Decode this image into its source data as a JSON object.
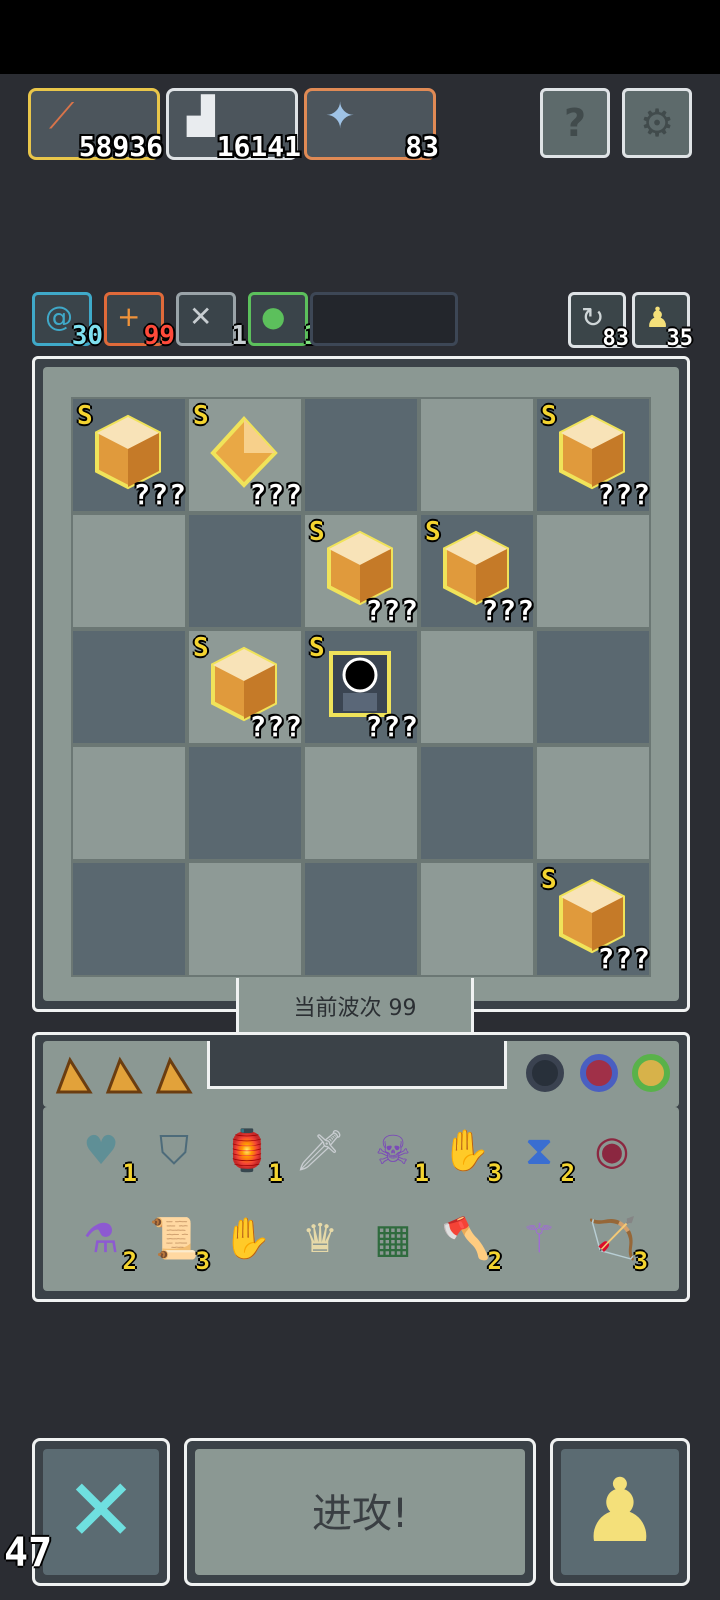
{
  "resources": [
    {
      "icon": "axe-icon",
      "glyph": "🪓",
      "value": "58936"
    },
    {
      "icon": "anvil-icon",
      "glyph": "⚒",
      "value": "16141"
    },
    {
      "icon": "crossbow-icon",
      "glyph": "🏹",
      "value": "83"
    }
  ],
  "top_buttons": {
    "help_glyph": "?",
    "settings_glyph": "⚙"
  },
  "status_chips": [
    {
      "icon": "spiral-icon",
      "glyph": "@",
      "value": "30",
      "color": "#3fa9c9"
    },
    {
      "icon": "plus-icon",
      "glyph": "+",
      "value": "99",
      "color": "#e06a3a"
    },
    {
      "icon": "swords-icon",
      "glyph": "✕",
      "value": "1",
      "color": "#9aa3a8"
    },
    {
      "icon": "leaf-icon",
      "glyph": "●",
      "value": "1",
      "color": "#5cc05c"
    }
  ],
  "mini_counters": [
    {
      "icon": "refresh-icon",
      "glyph": "↻",
      "value": "83"
    },
    {
      "icon": "pawn-icon",
      "glyph": "♟",
      "value": "35"
    }
  ],
  "board": {
    "cells": [
      {
        "rank": "S",
        "label": "???",
        "item": "cube-gem"
      },
      {
        "rank": "S",
        "label": "???",
        "item": "diamond-gem"
      },
      null,
      null,
      {
        "rank": "S",
        "label": "???",
        "item": "cube-gem"
      },
      null,
      null,
      {
        "rank": "S",
        "label": "???",
        "item": "cube-gem"
      },
      {
        "rank": "S",
        "label": "???",
        "item": "cube-gem"
      },
      null,
      null,
      {
        "rank": "S",
        "label": "???",
        "item": "cube-gem"
      },
      {
        "rank": "S",
        "label": "???",
        "item": "dark-portal"
      },
      null,
      null,
      null,
      null,
      null,
      null,
      null,
      null,
      null,
      null,
      null,
      {
        "rank": "S",
        "label": "???",
        "item": "cube-gem"
      }
    ]
  },
  "wave_label": "当前波次 99",
  "inventory": {
    "items": [
      {
        "icon": "heart-shield-icon",
        "glyph": "♥",
        "count": "1",
        "color": "#5f8f96"
      },
      {
        "icon": "shield-icon",
        "glyph": "⛉",
        "count": "",
        "color": "#4d6b7a"
      },
      {
        "icon": "lantern-icon",
        "glyph": "🏮",
        "count": "1",
        "color": "#d77a4a"
      },
      {
        "icon": "dagger-icon",
        "glyph": "🗡",
        "count": "",
        "color": "#c9cdd1"
      },
      {
        "icon": "demon-mask-icon",
        "glyph": "☠",
        "count": "1",
        "color": "#7b4bb7"
      },
      {
        "icon": "green-hand-icon",
        "glyph": "✋",
        "count": "3",
        "color": "#4caf50"
      },
      {
        "icon": "hourglass-icon",
        "glyph": "⧗",
        "count": "2",
        "color": "#3a6ed1"
      },
      {
        "icon": "eye-orb-icon",
        "glyph": "◉",
        "count": "",
        "color": "#8b2740"
      },
      {
        "icon": "potion-icon",
        "glyph": "⚗",
        "count": "2",
        "color": "#8d5ad1"
      },
      {
        "icon": "map-scroll-icon",
        "glyph": "📜",
        "count": "3",
        "color": "#d8ccb6"
      },
      {
        "icon": "eye-palm-icon",
        "glyph": "✋",
        "count": "",
        "color": "#e7a597"
      },
      {
        "icon": "crown-claw-icon",
        "glyph": "♛",
        "count": "",
        "color": "#e6d9a8"
      },
      {
        "icon": "vine-book-icon",
        "glyph": "▦",
        "count": "",
        "color": "#2f6b3e"
      },
      {
        "icon": "axe-icon",
        "glyph": "🪓",
        "count": "2",
        "color": "#d9744a"
      },
      {
        "icon": "staff-icon",
        "glyph": "⚚",
        "count": "",
        "color": "#a06bd6"
      },
      {
        "icon": "crossbow-icon",
        "glyph": "🏹",
        "count": "3",
        "color": "#9fc3e6"
      }
    ],
    "tabs": [
      "triangle-tab-1",
      "triangle-tab-2",
      "triangle-tab-3"
    ],
    "rings": [
      {
        "icon": "dark-ring-icon",
        "color": "#3a4250"
      },
      {
        "icon": "red-blue-ring-icon",
        "color": "#4a5fc1"
      },
      {
        "icon": "green-ring-icon",
        "color": "#59b24a"
      }
    ]
  },
  "actions": {
    "cancel_glyph": "✕",
    "attack_label": "进攻!",
    "pawn_glyph": "♟"
  },
  "fps": "47"
}
